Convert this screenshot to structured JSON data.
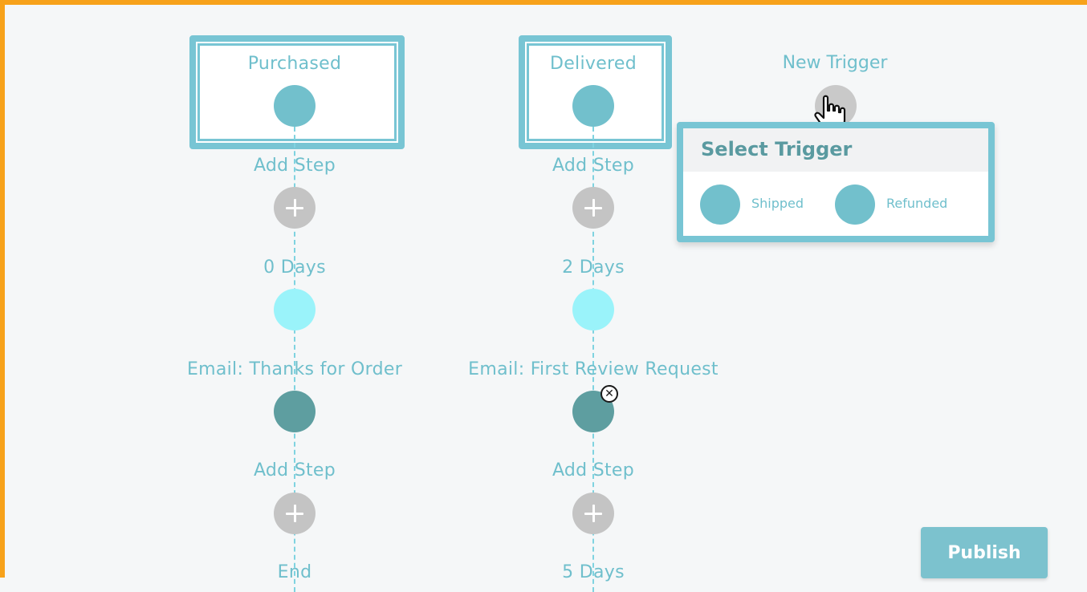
{
  "workflow": {
    "purchased": {
      "trigger_label": "Purchased",
      "add_step_1": "Add Step",
      "delay": "0 Days",
      "email": "Email: Thanks for Order",
      "add_step_2": "Add Step",
      "end": "End"
    },
    "delivered": {
      "trigger_label": "Delivered",
      "add_step_1": "Add Step",
      "delay": "2 Days",
      "email": "Email: First Review Request",
      "add_step_2": "Add Step",
      "delay_2": "5 Days"
    },
    "new_trigger": {
      "label": "New Trigger"
    }
  },
  "select_trigger_popup": {
    "title": "Select Trigger",
    "options": [
      {
        "label": "Shipped"
      },
      {
        "label": "Refunded"
      }
    ]
  },
  "publish_label": "Publish",
  "colors": {
    "accent": "#78c5d4",
    "trigger_dot": "#72c0cc",
    "delay_dot": "#9af3fa",
    "email_dot": "#5e9ea0",
    "add_dot": "#c4c4c4",
    "frame": "#f7a21b"
  },
  "icons": {
    "add": "plus-icon",
    "remove": "close-icon",
    "cursor": "hand-pointer-icon"
  }
}
